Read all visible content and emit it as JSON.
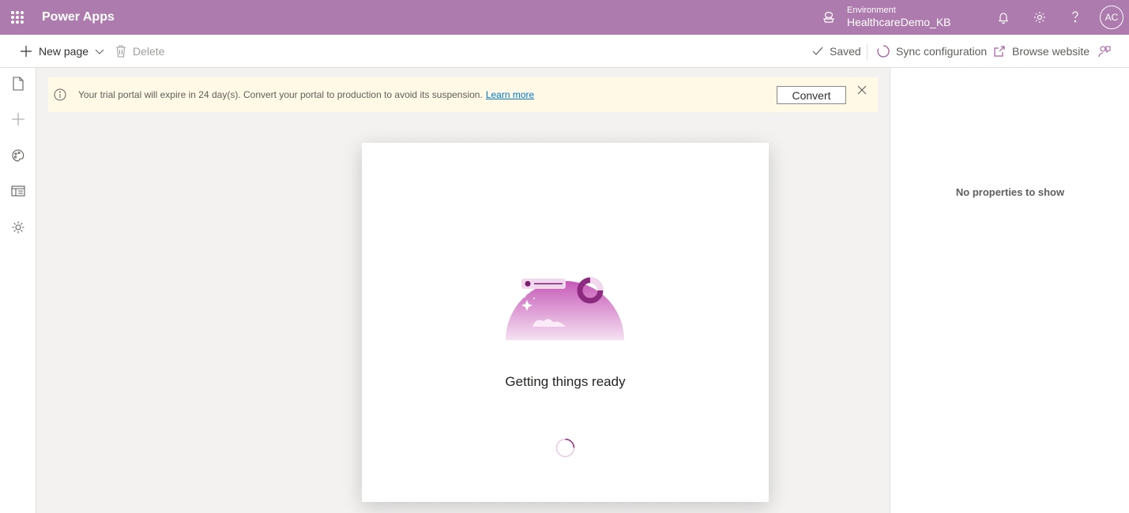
{
  "header": {
    "app_name": "Power Apps",
    "environment_label": "Environment",
    "environment_name": "HealthcareDemo_KB",
    "avatar_initials": "AC",
    "icons": [
      "waffle-icon",
      "environment-icon",
      "bell-icon",
      "gear-icon",
      "help-icon"
    ],
    "brand_color": "#ad7bad"
  },
  "toolbar": {
    "new_page_label": "New page",
    "delete_label": "Delete",
    "saved_label": "Saved",
    "sync_label": "Sync configuration",
    "browse_label": "Browse website"
  },
  "left_rail": {
    "items": [
      "pages-icon",
      "add-icon",
      "theme-icon",
      "templates-icon",
      "settings-icon"
    ]
  },
  "banner": {
    "message": "Your trial portal will expire in 24 day(s). Convert your portal to production to avoid its suspension.",
    "link_label": "Learn more",
    "convert_label": "Convert",
    "background_color": "#fff9e6"
  },
  "loading": {
    "title": "Getting things ready"
  },
  "properties": {
    "empty_text": "No properties to show"
  }
}
